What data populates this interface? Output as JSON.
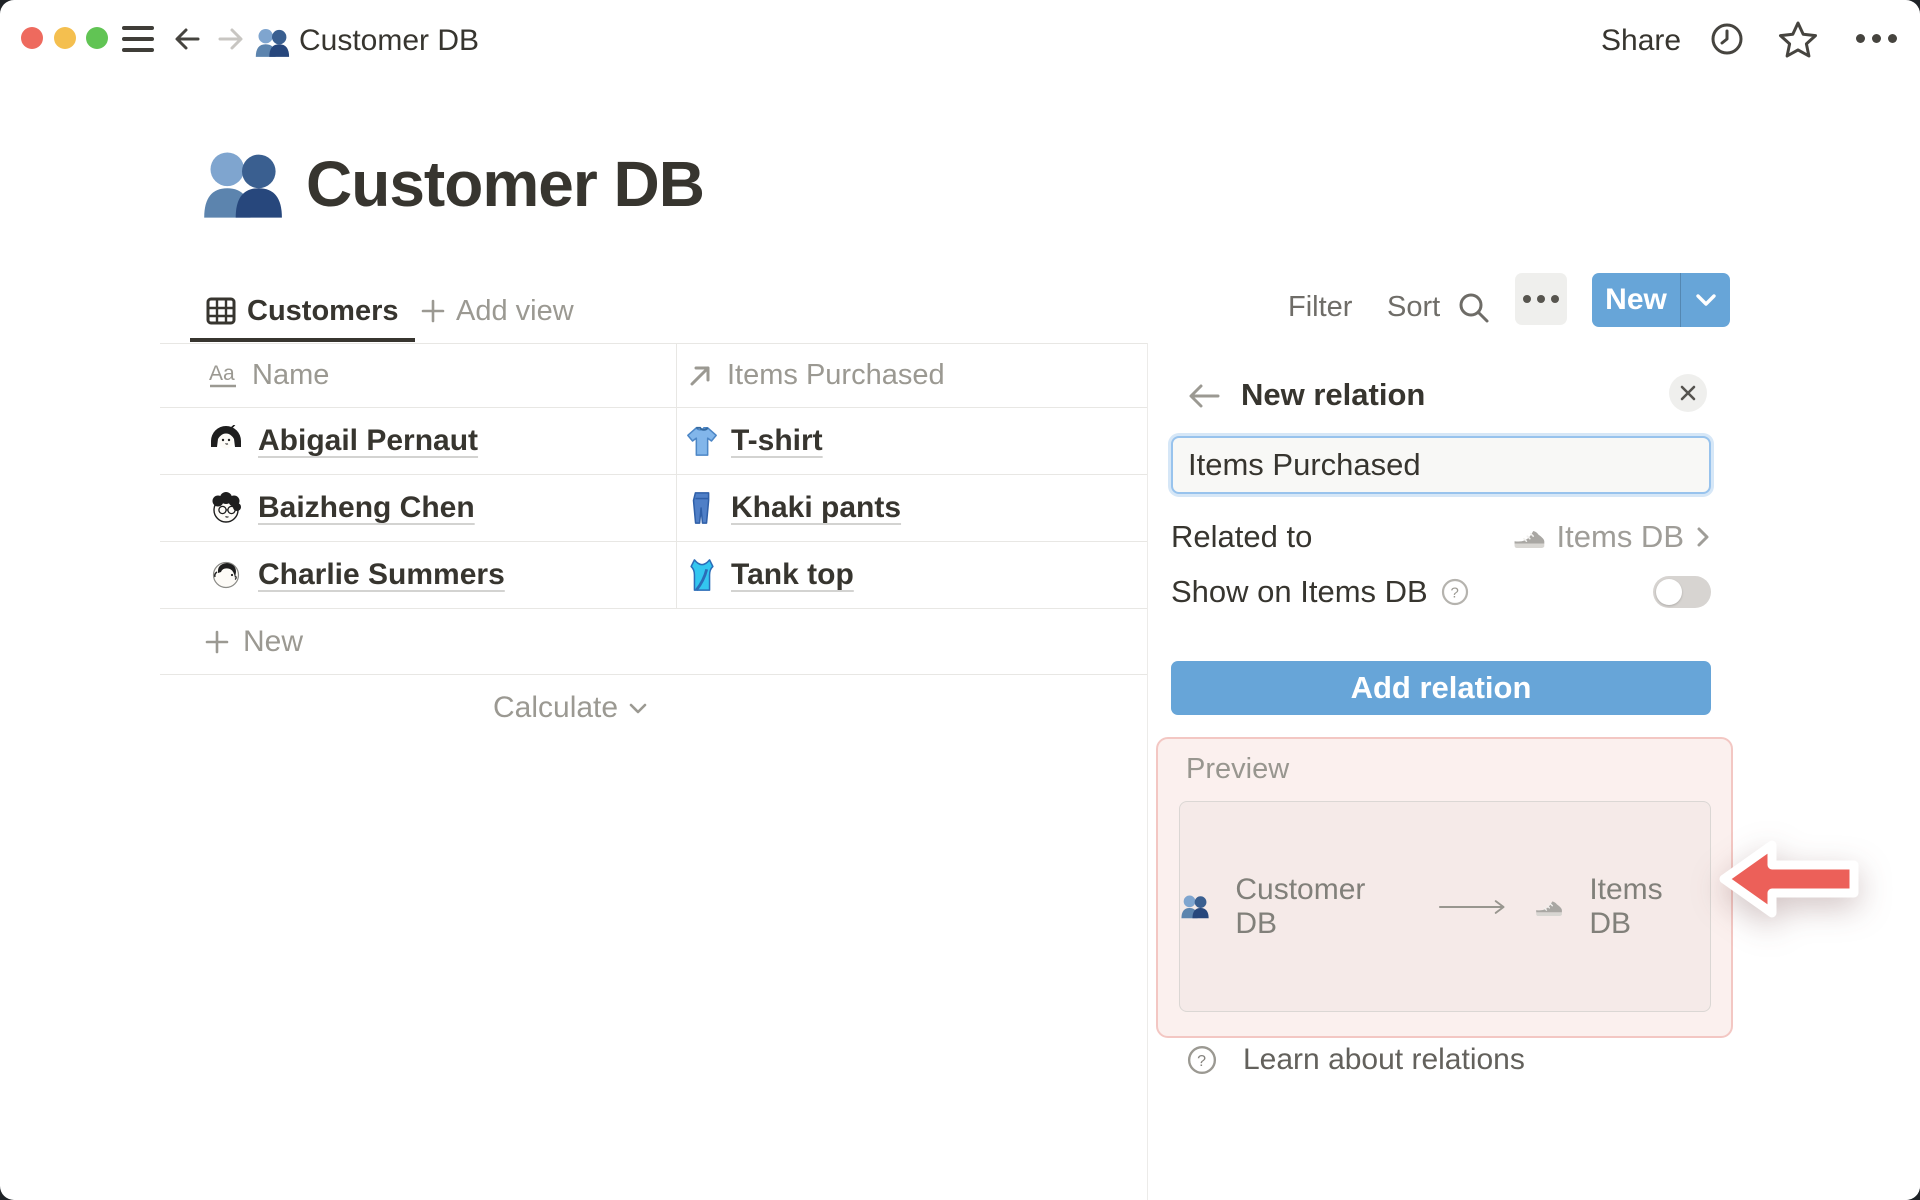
{
  "topbar": {
    "doc_title": "Customer DB",
    "share_label": "Share"
  },
  "page": {
    "title": "Customer DB",
    "icon": "people-icon"
  },
  "viewbar": {
    "active_view": "Customers",
    "add_view_label": "Add view",
    "filter_label": "Filter",
    "sort_label": "Sort",
    "new_label": "New"
  },
  "table": {
    "columns": [
      {
        "label": "Name",
        "icon": "text-property-icon"
      },
      {
        "label": "Items Purchased",
        "icon": "relation-arrow-icon"
      }
    ],
    "rows": [
      {
        "name": "Abigail Pernaut",
        "item": "T-shirt",
        "item_icon": "tshirt-icon"
      },
      {
        "name": "Baizheng Chen",
        "item": "Khaki pants",
        "item_icon": "jeans-icon"
      },
      {
        "name": "Charlie Summers",
        "item": "Tank top",
        "item_icon": "tank-top-icon"
      }
    ],
    "new_row_label": "New",
    "calculate_label": "Calculate"
  },
  "panel": {
    "title": "New relation",
    "name_value": "Items Purchased",
    "related": {
      "label": "Related to",
      "value": "Items DB",
      "icon": "sneaker-icon"
    },
    "show_on": {
      "label": "Show on Items DB",
      "enabled": false
    },
    "add_button_label": "Add relation",
    "preview": {
      "label": "Preview",
      "from": "Customer DB",
      "from_icon": "people-icon",
      "to": "Items DB",
      "to_icon": "sneaker-icon"
    },
    "learn_label": "Learn about relations"
  },
  "colors": {
    "accent_blue": "#67a5d8",
    "text_dark": "#37352f",
    "text_gray": "#9b9992",
    "highlight_pink_bg": "#fbf0ee",
    "highlight_pink_border": "#f3c7c3",
    "annotation_red": "#ec6059"
  }
}
